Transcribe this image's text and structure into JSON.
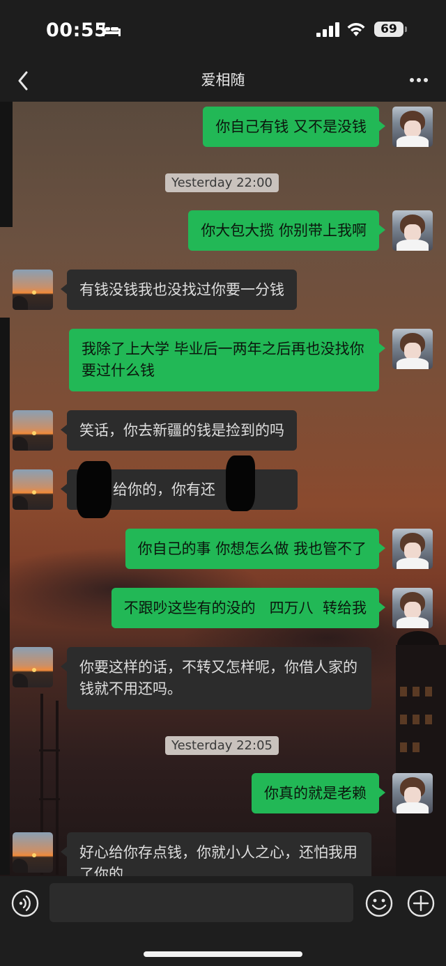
{
  "status_bar": {
    "time": "00:55",
    "battery": "69"
  },
  "nav": {
    "title": "爱相随",
    "back_icon": "chevron-left-icon",
    "more_icon": "ellipsis-icon"
  },
  "messages": [
    {
      "side": "me",
      "text": "你自己有钱  又不是没钱"
    },
    {
      "type": "timestamp",
      "text": "Yesterday 22:00"
    },
    {
      "side": "me",
      "text": "你大包大揽 你别带上我啊"
    },
    {
      "side": "other",
      "text": "有钱没钱我也没找过你要一分钱"
    },
    {
      "side": "me",
      "text": "我除了上大学 毕业后一两年之后再也没找你要过什么钱"
    },
    {
      "side": "other",
      "text": "笑话，你去新疆的钱是捡到的吗"
    },
    {
      "side": "other",
      "text": "给你的，你有还    吗。",
      "redacted": true
    },
    {
      "side": "me",
      "text": "你自己的事 你想怎么做 我也管不了"
    },
    {
      "side": "me",
      "text": "不跟吵这些有的没的   四万八  转给我"
    },
    {
      "side": "other",
      "text": "你要这样的话，不转又怎样呢，你借人家的钱就不用还吗。"
    },
    {
      "type": "timestamp",
      "text": "Yesterday 22:05"
    },
    {
      "side": "me",
      "text": "你真的就是老赖"
    },
    {
      "side": "other",
      "text": "好心给你存点钱，你就小人之心，还怕我用了你的"
    }
  ],
  "input_bar": {
    "placeholder": "",
    "left_icon": "voice-icon",
    "emoji_icon": "emoji-icon",
    "plus_icon": "plus-icon"
  }
}
